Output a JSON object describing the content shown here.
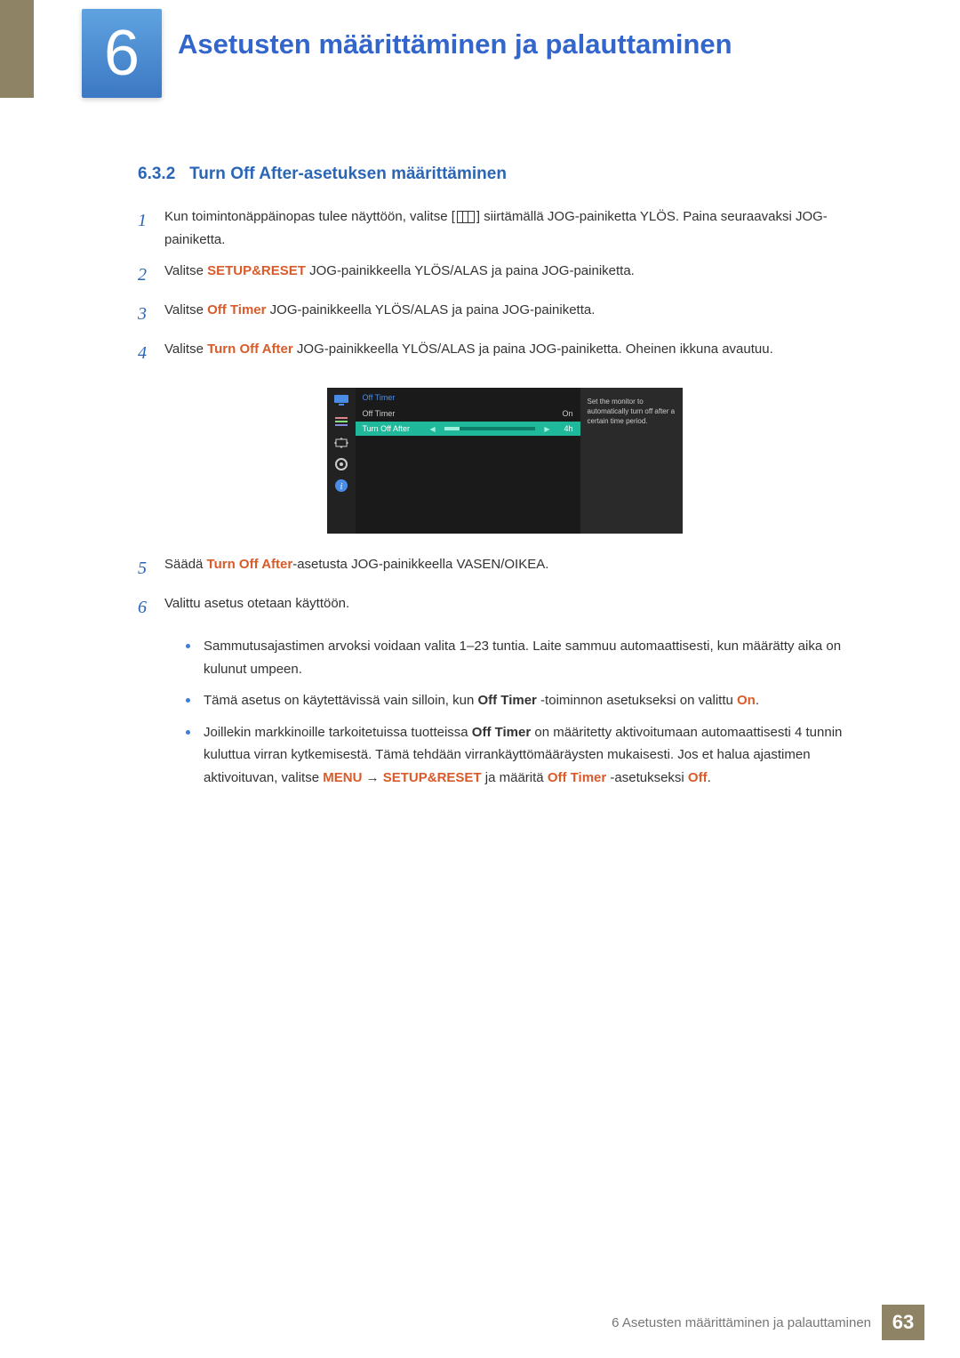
{
  "chapter": {
    "number": "6",
    "title": "Asetusten määrittäminen ja palauttaminen"
  },
  "section": {
    "number": "6.3.2",
    "title": "Turn Off After-asetuksen määrittäminen"
  },
  "steps": {
    "s1a": "Kun toimintonäppäinopas tulee näyttöön, valitse [",
    "s1b": "] siirtämällä JOG-painiketta YLÖS. Paina seuraavaksi JOG-painiketta.",
    "s2a": "Valitse ",
    "s2_bold": "SETUP&RESET",
    "s2b": " JOG-painikkeella YLÖS/ALAS ja paina JOG-painiketta.",
    "s3a": "Valitse ",
    "s3_bold": "Off Timer",
    "s3b": " JOG-painikkeella YLÖS/ALAS ja paina JOG-painiketta.",
    "s4a": "Valitse ",
    "s4_bold": "Turn Off After",
    "s4b": " JOG-painikkeella YLÖS/ALAS ja paina JOG-painiketta. Oheinen ikkuna avautuu.",
    "s5a": "Säädä ",
    "s5_bold": "Turn Off After",
    "s5b": "-asetusta JOG-painikkeella VASEN/OIKEA.",
    "s6": "Valittu asetus otetaan käyttöön."
  },
  "osd": {
    "menu_title": "Off Timer",
    "row1_label": "Off Timer",
    "row1_value": "On",
    "row2_label": "Turn Off After",
    "row2_value": "4h",
    "side_text": "Set the monitor to automatically turn off after a certain time period."
  },
  "notes": {
    "n1": "Sammutusajastimen arvoksi voidaan valita 1–23 tuntia. Laite sammuu automaattisesti, kun määrätty aika on kulunut umpeen.",
    "n2a": "Tämä asetus on käytettävissä vain silloin, kun ",
    "n2_off_timer": "Off Timer",
    "n2b": " -toiminnon asetukseksi on valittu ",
    "n2_on": "On",
    "n2c": ".",
    "n3a": "Joillekin markkinoille tarkoitetuissa tuotteissa ",
    "n3_off_timer": "Off Timer",
    "n3b": " on määritetty aktivoitumaan automaattisesti 4 tunnin kuluttua virran kytkemisestä. Tämä tehdään virrankäyttömääräysten mukaisesti. Jos et halua ajastimen aktivoituvan, valitse ",
    "n3_menu": "MENU",
    "n3_arrow": " → ",
    "n3_setup": "SETUP&RESET",
    "n3c": " ja määritä ",
    "n3_off_timer2": "Off Timer",
    "n3d": " -asetukseksi ",
    "n3_off": "Off",
    "n3e": "."
  },
  "footer": {
    "text": "6 Asetusten määrittäminen ja palauttaminen",
    "page": "63"
  }
}
